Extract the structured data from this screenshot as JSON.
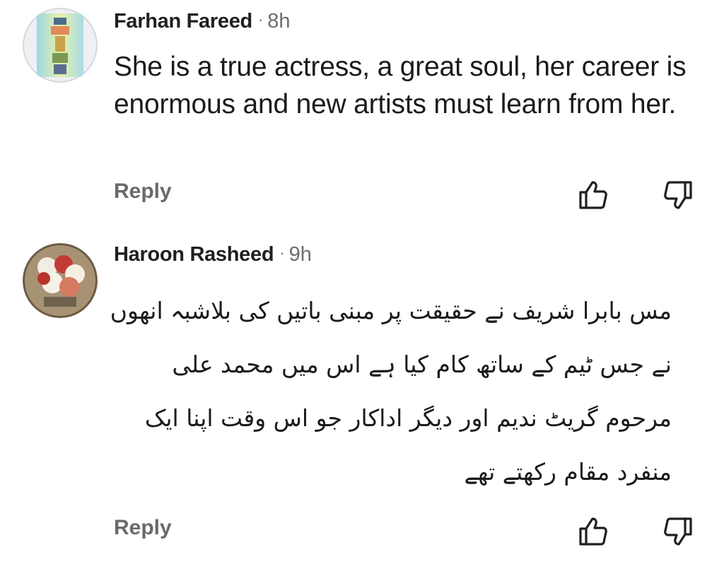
{
  "comments": [
    {
      "author": "Farhan Fareed",
      "separator": "·",
      "time": "8h",
      "text": "She is a true actress, a great soul, her career is enormous and new artists must learn from her.",
      "reply_label": "Reply",
      "like_icon": "thumbs-up-icon",
      "dislike_icon": "thumbs-down-icon"
    },
    {
      "author": "Haroon Rasheed",
      "separator": "·",
      "time": "9h",
      "text": "مس بابرا شریف نے حقیقت پر مبنی باتیں کی بلاشبہ انھوں نے جس ٹیم کے ساتھ کام کیا ہے اس میں محمد علی مرحوم گریٹ ندیم اور دیگر اداکار جو اس وقت اپنا ایک منفرد مقام رکھتے تھے",
      "reply_label": "Reply",
      "like_icon": "thumbs-up-icon",
      "dislike_icon": "thumbs-down-icon"
    }
  ],
  "colors": {
    "text": "#1b1b1b",
    "meta": "#6d6d6d",
    "reply": "#6a6a6a",
    "background": "#ffffff"
  }
}
